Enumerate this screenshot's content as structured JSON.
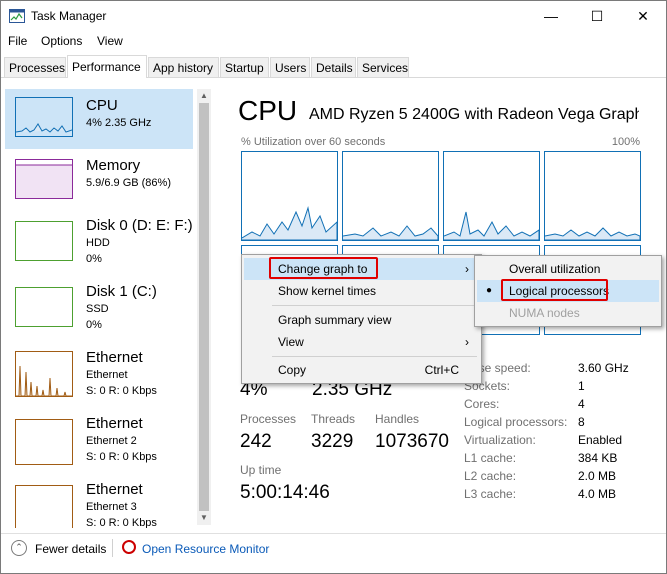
{
  "window": {
    "title": "Task Manager"
  },
  "menubar": [
    "File",
    "Options",
    "View"
  ],
  "tabs": [
    "Processes",
    "Performance",
    "App history",
    "Startup",
    "Users",
    "Details",
    "Services"
  ],
  "sidebar": [
    {
      "title": "CPU",
      "sub": [
        "4%  2.35 GHz"
      ],
      "color": "#1170b5"
    },
    {
      "title": "Memory",
      "sub": [
        "5.9/6.9 GB (86%)"
      ],
      "color": "#8b2a9a"
    },
    {
      "title": "Disk 0 (D: E: F:)",
      "sub": [
        "HDD",
        "0%"
      ],
      "color": "#4da030"
    },
    {
      "title": "Disk 1 (C:)",
      "sub": [
        "SSD",
        "0%"
      ],
      "color": "#4da030"
    },
    {
      "title": "Ethernet",
      "sub": [
        "Ethernet",
        "S: 0  R: 0 Kbps"
      ],
      "color": "#a15c14"
    },
    {
      "title": "Ethernet",
      "sub": [
        "Ethernet 2",
        "S: 0  R: 0 Kbps"
      ],
      "color": "#a15c14"
    },
    {
      "title": "Ethernet",
      "sub": [
        "Ethernet 3",
        "S: 0  R: 0 Kbps"
      ],
      "color": "#a15c14"
    }
  ],
  "main": {
    "title": "CPU",
    "cpu_name": "AMD Ryzen 5 2400G with Radeon Vega Graphi...",
    "util_label": "% Utilization over 60 seconds",
    "util_max": "100%",
    "stats": {
      "utilization_value": "4%",
      "speed_value": "2.35 GHz",
      "processes_label": "Processes",
      "processes_value": "242",
      "threads_label": "Threads",
      "threads_value": "3229",
      "handles_label": "Handles",
      "handles_value": "1073670",
      "uptime_label": "Up time",
      "uptime_value": "5:00:14:46"
    },
    "info": [
      {
        "label": "Base speed:",
        "value": "3.60 GHz"
      },
      {
        "label": "Sockets:",
        "value": "1"
      },
      {
        "label": "Cores:",
        "value": "4"
      },
      {
        "label": "Logical processors:",
        "value": "8"
      },
      {
        "label": "Virtualization:",
        "value": "Enabled"
      },
      {
        "label": "L1 cache:",
        "value": "384 KB"
      },
      {
        "label": "L2 cache:",
        "value": "2.0 MB"
      },
      {
        "label": "L3 cache:",
        "value": "4.0 MB"
      }
    ]
  },
  "context_menu": {
    "items": [
      {
        "label": "Change graph to",
        "shortcut": "",
        "arrow": "›"
      },
      {
        "label": "Show kernel times",
        "shortcut": "",
        "arrow": ""
      },
      {
        "label": "Graph summary view",
        "shortcut": "",
        "arrow": ""
      },
      {
        "label": "View",
        "shortcut": "",
        "arrow": "›"
      },
      {
        "label": "Copy",
        "shortcut": "Ctrl+C",
        "arrow": ""
      }
    ],
    "submenu": [
      {
        "label": "Overall utilization",
        "selected": false,
        "disabled": false
      },
      {
        "label": "Logical processors",
        "selected": true,
        "disabled": false
      },
      {
        "label": "NUMA nodes",
        "selected": false,
        "disabled": true
      }
    ]
  },
  "footer": {
    "fewer_details": "Fewer details",
    "open_monitor": "Open Resource Monitor"
  },
  "colors": {
    "accent": "#1170b5",
    "highlight": "#cce4f7",
    "annotation": "#e00000"
  }
}
